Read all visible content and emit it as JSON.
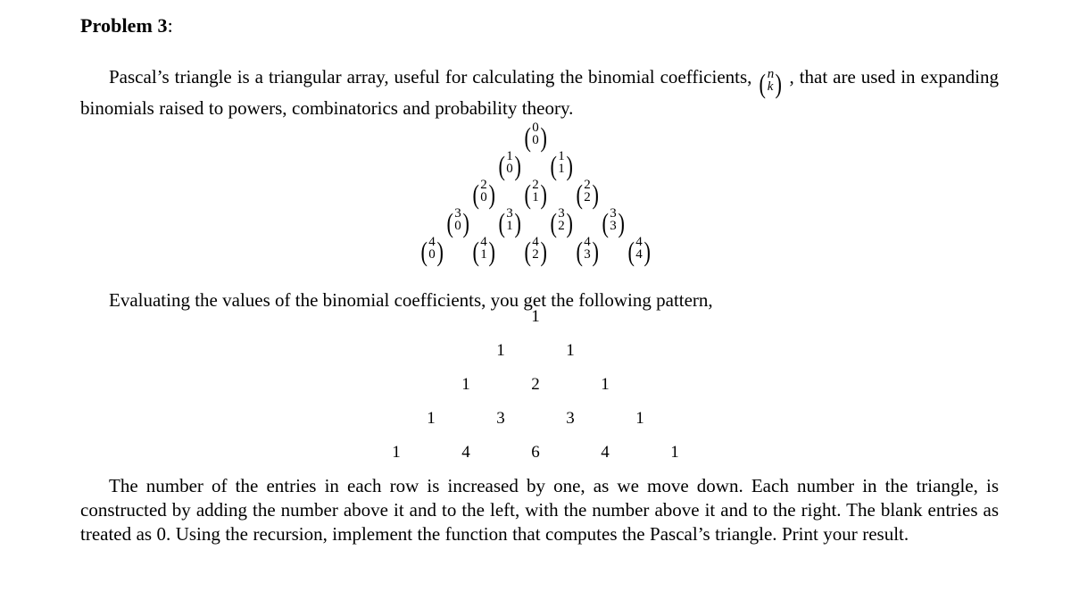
{
  "document": {
    "heading": {
      "label": "Problem 3",
      "colon": ":"
    },
    "intro_paragraph": {
      "before_binom": "Pascal’s triangle is a triangular array, useful for calculating the binomial coefficients, ",
      "binom": {
        "top": "n",
        "bottom": "k"
      },
      "after_binom": " , that are used in expanding binomials raised to powers, combinatorics and probability theory."
    },
    "symbolic_triangle": {
      "description": "Pascal's triangle written with binomial coefficient symbols",
      "rows": [
        [
          {
            "top": "0",
            "bottom": "0"
          }
        ],
        [
          {
            "top": "1",
            "bottom": "0"
          },
          {
            "top": "1",
            "bottom": "1"
          }
        ],
        [
          {
            "top": "2",
            "bottom": "0"
          },
          {
            "top": "2",
            "bottom": "1"
          },
          {
            "top": "2",
            "bottom": "2"
          }
        ],
        [
          {
            "top": "3",
            "bottom": "0"
          },
          {
            "top": "3",
            "bottom": "1"
          },
          {
            "top": "3",
            "bottom": "2"
          },
          {
            "top": "3",
            "bottom": "3"
          }
        ],
        [
          {
            "top": "4",
            "bottom": "0"
          },
          {
            "top": "4",
            "bottom": "1"
          },
          {
            "top": "4",
            "bottom": "2"
          },
          {
            "top": "4",
            "bottom": "3"
          },
          {
            "top": "4",
            "bottom": "4"
          }
        ]
      ]
    },
    "evaluating_line": "Evaluating the values of the binomial coefficients, you get the following pattern,",
    "numeric_triangle": {
      "description": "Pascal's triangle with evaluated values",
      "rows": [
        [
          "1"
        ],
        [
          "1",
          "1"
        ],
        [
          "1",
          "2",
          "1"
        ],
        [
          "1",
          "3",
          "3",
          "1"
        ],
        [
          "1",
          "4",
          "6",
          "4",
          "1"
        ]
      ]
    },
    "final_paragraph": "The number of the entries in each row is increased by one, as we move down. Each number in the triangle, is constructed by adding the number above it and to the left, with the number above it and to the right. The blank entries as treated as 0. Using the recursion, implement the function that computes the Pascal’s triangle. Print your result."
  }
}
